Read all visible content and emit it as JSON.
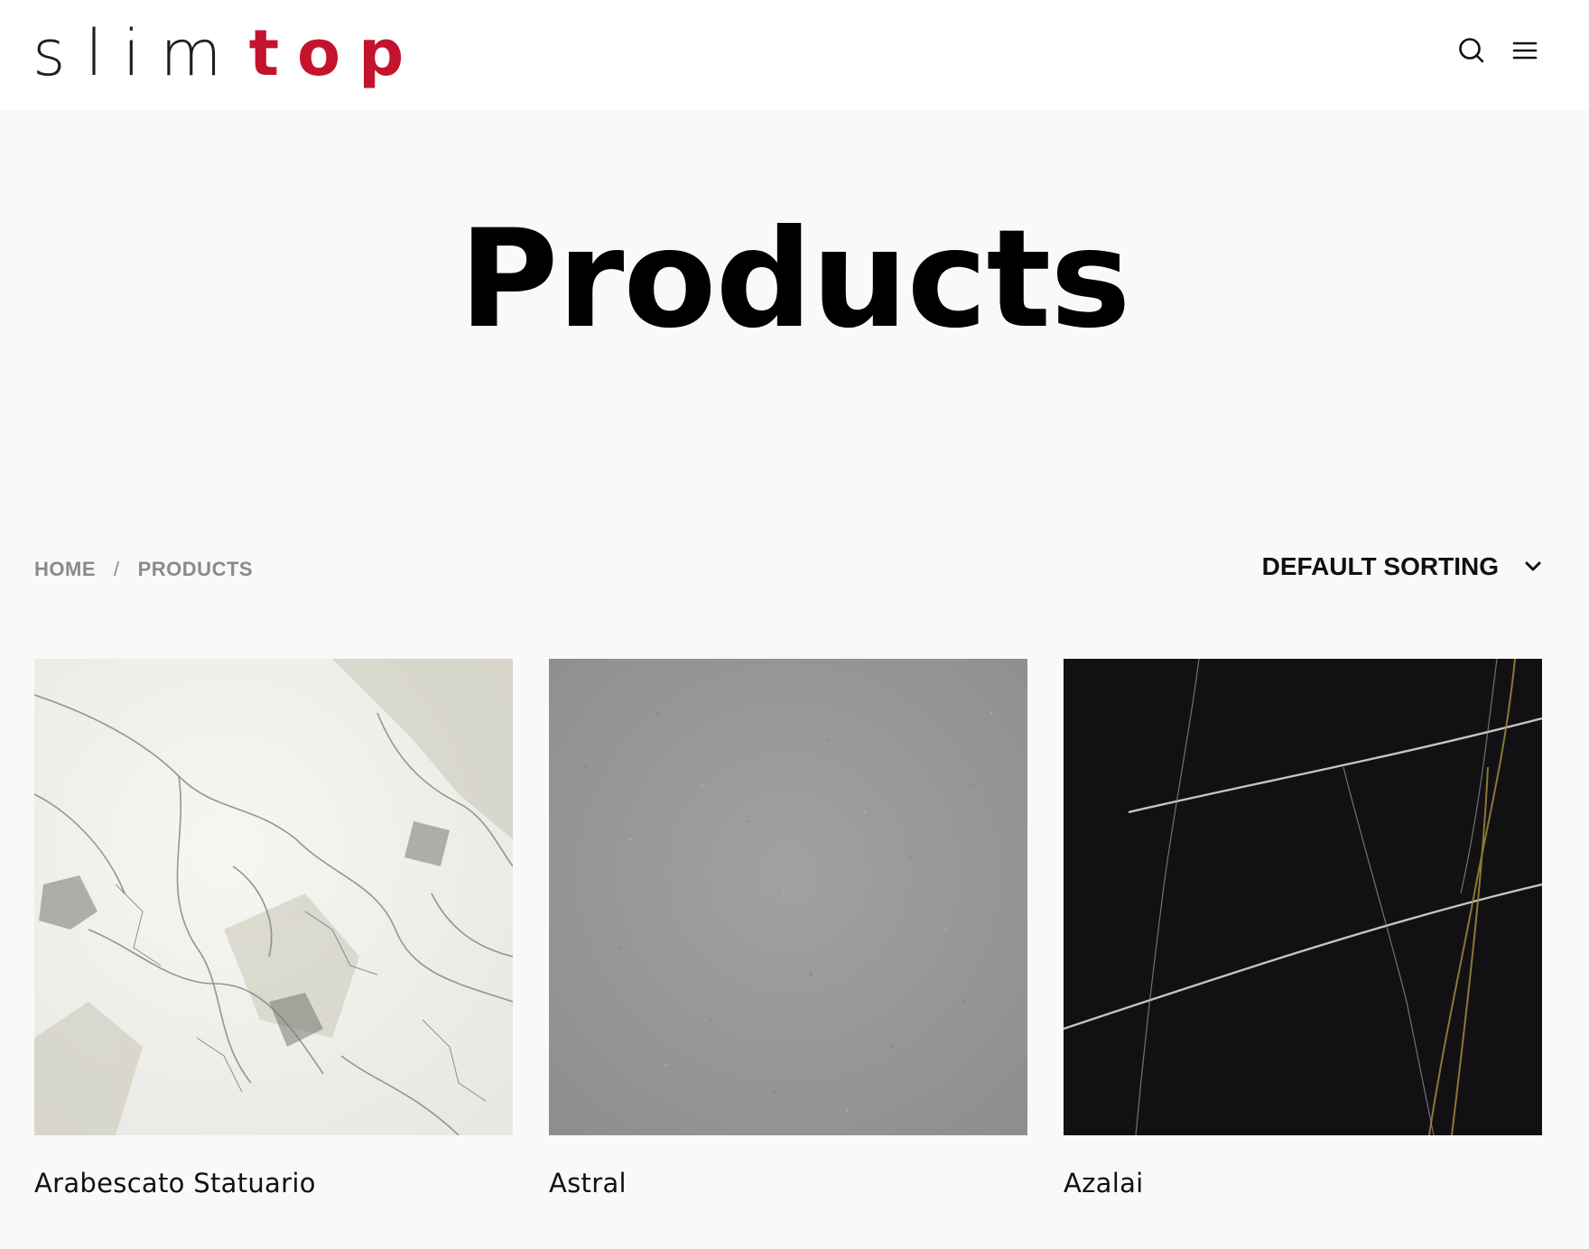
{
  "header": {
    "logo_light": "slim",
    "logo_bold": "top",
    "logo_bold_color": "#c4142d",
    "icons": [
      "search-icon",
      "menu-icon"
    ]
  },
  "page": {
    "title": "Products"
  },
  "breadcrumb": {
    "home": "HOME",
    "separator": "/",
    "current": "PRODUCTS"
  },
  "sorting": {
    "selected": "DEFAULT SORTING",
    "icon": "chevron-down-icon"
  },
  "products": [
    {
      "name": "Arabescato Statuario",
      "texture": "white-marble"
    },
    {
      "name": "Astral",
      "texture": "grey-concrete"
    },
    {
      "name": "Azalai",
      "texture": "black-marble"
    }
  ]
}
